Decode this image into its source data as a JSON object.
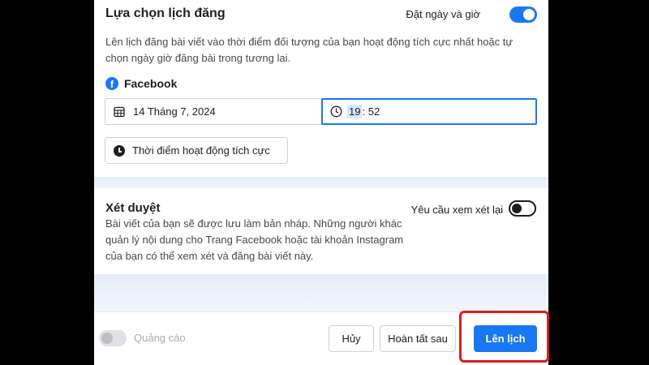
{
  "schedule": {
    "title": "Lựa chọn lịch đăng",
    "toggle_label": "Đặt ngày và giờ",
    "toggle_on": true,
    "description": "Lên lịch đăng bài viết vào thời điểm đối tượng của bạn hoạt động tích cực nhất hoặc tự chọn ngày giờ đăng bài trong tương lai.",
    "platform": "Facebook",
    "platform_icon": "facebook-icon",
    "date_value": "14 Tháng 7, 2024",
    "date_icon": "calendar-icon",
    "time_hour": "19",
    "time_separator": ":",
    "time_minute": "52",
    "time_icon": "clock-icon",
    "active_times_button": "Thời điểm hoạt động tích cực"
  },
  "review": {
    "title": "Xét duyệt",
    "toggle_label": "Yêu cầu xem xét lại",
    "toggle_on": false,
    "description": "Bài viết của bạn sẽ được lưu làm bản nháp. Những người khác quản lý nội dung cho Trang Facebook hoặc tài khoản Instagram của bạn có thể xem xét và đăng bài viết này."
  },
  "footer": {
    "ads_label": "Quảng cáo",
    "cancel_label": "Hủy",
    "finish_later_label": "Hoàn tất sau",
    "schedule_label": "Lên lịch"
  },
  "colors": {
    "accent": "#1877f2",
    "highlight": "#d91e1e"
  }
}
